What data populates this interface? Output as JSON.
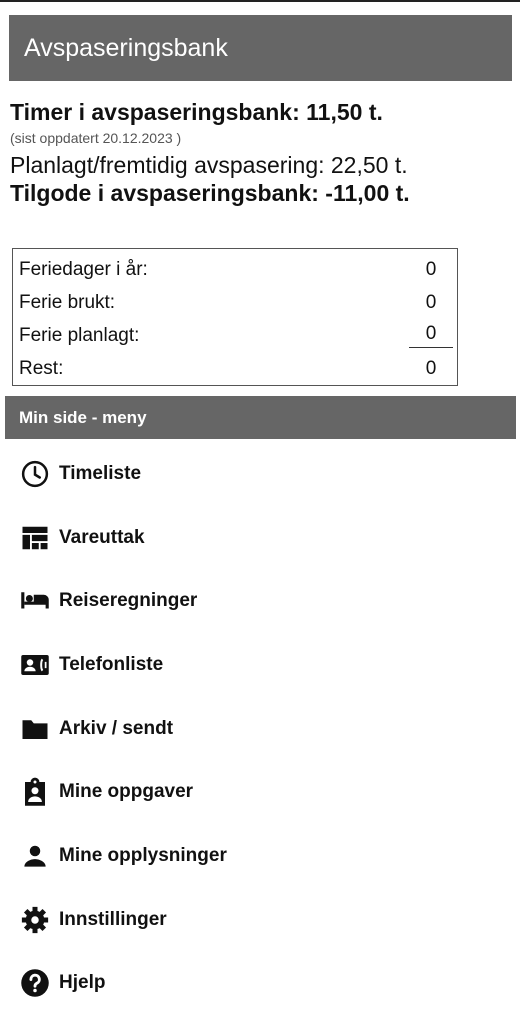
{
  "header": {
    "title": "Avspaseringsbank"
  },
  "bank": {
    "timer": "Timer i avspaseringsbank: 11,50 t.",
    "updated": "(sist oppdatert 20.12.2023 )",
    "planned": "Planlagt/fremtidig avspasering: 22,50 t.",
    "credit": "Tilgode i avspaseringsbank: -11,00 t."
  },
  "vacation": {
    "rows": [
      {
        "label": "Feriedager i år:",
        "value": "0"
      },
      {
        "label": "Ferie brukt:",
        "value": "0"
      },
      {
        "label": "Ferie planlagt:",
        "value": "0"
      },
      {
        "label": "Rest:",
        "value": "0"
      }
    ]
  },
  "menu": {
    "title": "Min side - meny",
    "items": [
      {
        "label": "Timeliste",
        "icon": "clock-icon"
      },
      {
        "label": "Vareuttak",
        "icon": "dashboard-icon"
      },
      {
        "label": "Reiseregninger",
        "icon": "bed-icon"
      },
      {
        "label": "Telefonliste",
        "icon": "contact-phone-icon"
      },
      {
        "label": "Arkiv / sendt",
        "icon": "folder-icon"
      },
      {
        "label": "Mine oppgaver",
        "icon": "clipboard-person-icon"
      },
      {
        "label": "Mine opplysninger",
        "icon": "person-icon"
      },
      {
        "label": "Innstillinger",
        "icon": "gear-icon"
      },
      {
        "label": "Hjelp",
        "icon": "help-icon"
      }
    ]
  }
}
